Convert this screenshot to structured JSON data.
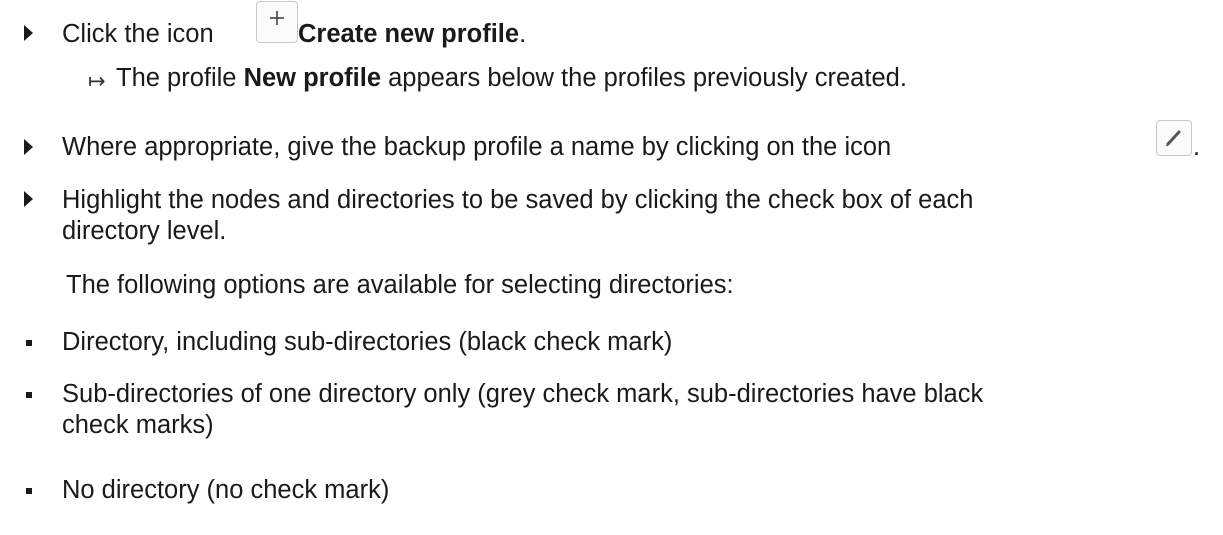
{
  "step1": {
    "prefix": "Click the icon",
    "bold": "Create new profile",
    "suffix": "."
  },
  "result1": {
    "prefix": "The profile",
    "bold": "New profile",
    "suffix": "appears below the profiles previously created."
  },
  "step2": {
    "text": "Where appropriate, give the backup profile a name by clicking on the icon",
    "suffix": "."
  },
  "step3": {
    "line1": "Highlight the nodes and directories to be saved by clicking the check box of each",
    "line2": "directory level."
  },
  "options_intro": "The following options are available for selecting directories:",
  "options": [
    {
      "line1": "Directory, including sub-directories (black check mark)"
    },
    {
      "line1": "Sub-directories of one directory only (grey check mark, sub-directories have black",
      "line2": "check marks)"
    },
    {
      "line1": "No directory (no check mark)"
    }
  ],
  "icons": {
    "step_bullet": "triangle-bullet",
    "result_bullet": "result-arrow",
    "create_profile": "plus-icon",
    "rename_profile": "pencil-icon",
    "option_bullet": "square-bullet"
  }
}
